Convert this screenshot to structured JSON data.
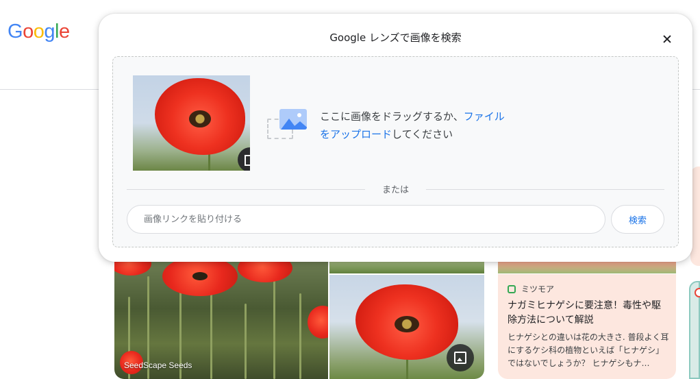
{
  "logo": {
    "letters": [
      "G",
      "o",
      "o",
      "g",
      "l",
      "e"
    ],
    "colors": [
      "#4285f4",
      "#ea4335",
      "#fbbc05",
      "#4285f4",
      "#34a853",
      "#ea4335"
    ]
  },
  "modal": {
    "title": "Google レンズで画像を検索",
    "drop_text_before": "ここに画像をドラッグするか、",
    "upload_link_1": "ファイル",
    "upload_link_2": "をアップロード",
    "drop_text_after": "してください",
    "or_label": "または",
    "url_placeholder": "画像リンクを貼り付ける",
    "search_label": "検索"
  },
  "results": {
    "tile1_label": "SeedScape Seeds",
    "card3": {
      "source": "ミツモア",
      "title": "ナガミヒナゲシに要注意！毒性や駆除方法について解説",
      "snippet": "ヒナゲシとの違いは花の大きさ. 普段よく耳にするケシ科の植物といえば「ヒナゲシ」ではないでしょうか？ ヒナゲシもナ…"
    }
  },
  "colors": {
    "accent": "#1a73e8",
    "card_bg": "#fde7df"
  }
}
